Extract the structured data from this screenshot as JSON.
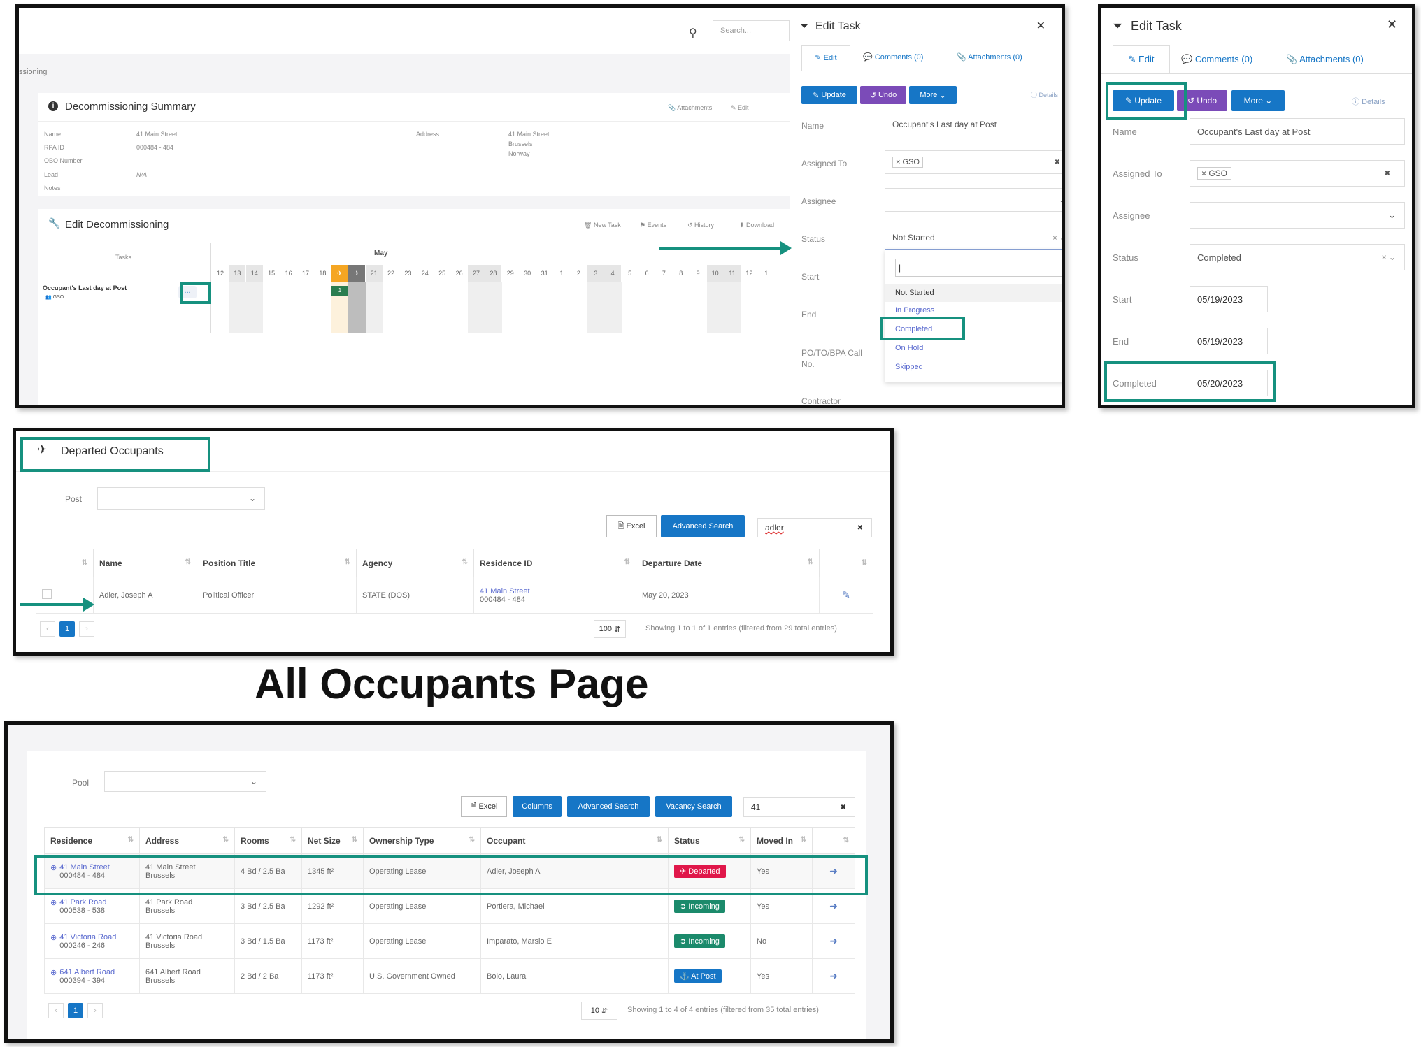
{
  "page_heading": "All Occupants Page",
  "panel1": {
    "search_placeholder": "Search...",
    "breadcrumb": "ssioning",
    "summary_title": "Decommissioning Summary",
    "summary_actions": [
      "Attachments",
      "Edit"
    ],
    "fields": [
      {
        "label": "Name",
        "value": "41 Main Street"
      },
      {
        "label": "RPA ID",
        "value": "000484 - 484"
      },
      {
        "label": "OBO Number",
        "value": ""
      },
      {
        "label": "Lead",
        "value": "N/A"
      },
      {
        "label": "Notes",
        "value": ""
      }
    ],
    "address_label": "Address",
    "address_lines": [
      "41 Main Street",
      "Brussels",
      "Norway"
    ],
    "edit_title": "Edit Decommissioning",
    "edit_actions": [
      "New Task",
      "Events",
      "History",
      "Download"
    ],
    "tasks_label": "Tasks",
    "month": "May",
    "days": [
      "12",
      "13",
      "14",
      "15",
      "16",
      "17",
      "18",
      "19",
      "20",
      "21",
      "22",
      "23",
      "24",
      "25",
      "26",
      "27",
      "28",
      "29",
      "30",
      "31",
      "1",
      "2",
      "3",
      "4",
      "5",
      "6",
      "7",
      "8",
      "9",
      "10",
      "11",
      "12",
      "1"
    ],
    "task_name": "Occupant's Last day at Post",
    "task_assignee": "GSO",
    "task_more": "...",
    "task_bar_label": "1",
    "drawer": {
      "title": "Edit Task",
      "tabs": [
        "Edit",
        "Comments (0)",
        "Attachments (0)"
      ],
      "update": "Update",
      "undo": "Undo",
      "more": "More",
      "details": "Details",
      "name_label": "Name",
      "name_value": "Occupant's Last day at Post",
      "assigned_label": "Assigned To",
      "assigned_value": "GSO",
      "assignee_label": "Assignee",
      "status_label": "Status",
      "status_value": "Not Started",
      "start_label": "Start",
      "end_label": "End",
      "po_label": "PO/TO/BPA Call No.",
      "contractor_label": "Contractor",
      "options": [
        "Not Started",
        "In Progress",
        "Completed",
        "On Hold",
        "Skipped"
      ]
    }
  },
  "panel2": {
    "title": "Edit Task",
    "tabs": [
      "Edit",
      "Comments (0)",
      "Attachments (0)"
    ],
    "update": "Update",
    "undo": "Undo",
    "more": "More",
    "details": "Details",
    "name_label": "Name",
    "name_value": "Occupant's Last day at Post",
    "assigned_label": "Assigned To",
    "assigned_value": "GSO",
    "assignee_label": "Assignee",
    "status_label": "Status",
    "status_value": "Completed",
    "start_label": "Start",
    "start_value": "05/19/2023",
    "end_label": "End",
    "end_value": "05/19/2023",
    "completed_label": "Completed",
    "completed_value": "05/20/2023"
  },
  "panel3": {
    "title": "Departed Occupants",
    "post_label": "Post",
    "excel": "Excel",
    "advanced_search": "Advanced Search",
    "search_value": "adler",
    "columns": [
      "Name",
      "Position Title",
      "Agency",
      "Residence ID",
      "Departure Date"
    ],
    "row": {
      "name": "Adler, Joseph A",
      "position": "Political Officer",
      "agency": "STATE (DOS)",
      "residence_line1": "41 Main Street",
      "residence_line2": "000484 - 484",
      "departure": "May 20, 2023"
    },
    "page": "1",
    "page_size": "100",
    "showing": "Showing 1 to 1 of 1 entries (filtered from 29 total entries)"
  },
  "panel4": {
    "pool_label": "Pool",
    "excel": "Excel",
    "columns_btn": "Columns",
    "advanced_search": "Advanced Search",
    "vacancy_search": "Vacancy Search",
    "search_value": "41",
    "columns": [
      "Residence",
      "Address",
      "Rooms",
      "Net Size",
      "Ownership Type",
      "Occupant",
      "Status",
      "Moved In"
    ],
    "rows": [
      {
        "res1": "41 Main Street",
        "res2": "000484 - 484",
        "addr1": "41 Main Street",
        "addr2": "Brussels",
        "rooms": "4 Bd / 2.5 Ba",
        "size": "1345 ft²",
        "own": "Operating Lease",
        "occupant": "Adler, Joseph A",
        "status": "Departed",
        "moved": "Yes"
      },
      {
        "res1": "41 Park Road",
        "res2": "000538 - 538",
        "addr1": "41 Park Road",
        "addr2": "Brussels",
        "rooms": "3 Bd / 2.5 Ba",
        "size": "1292 ft²",
        "own": "Operating Lease",
        "occupant": "Portiera, Michael",
        "status": "Incoming",
        "moved": "Yes"
      },
      {
        "res1": "41 Victoria Road",
        "res2": "000246 - 246",
        "addr1": "41 Victoria Road",
        "addr2": "Brussels",
        "rooms": "3 Bd / 1.5 Ba",
        "size": "1173 ft²",
        "own": "Operating Lease",
        "occupant": "Imparato, Marsio E",
        "status": "Incoming",
        "moved": "No"
      },
      {
        "res1": "641 Albert Road",
        "res2": "000394 - 394",
        "addr1": "641 Albert Road",
        "addr2": "Brussels",
        "rooms": "2 Bd / 2 Ba",
        "size": "1173 ft²",
        "own": "U.S. Government Owned",
        "occupant": "Bolo, Laura",
        "status": "At Post",
        "moved": "Yes"
      }
    ],
    "page": "1",
    "page_size": "10",
    "showing": "Showing 1 to 4 of 4 entries (filtered from 35 total entries)"
  },
  "colors": {
    "accent": "#16917f",
    "primary": "#1676c6",
    "purple": "#7b4bb8",
    "departed": "#e0174a",
    "incoming": "#1b8a6b",
    "atpost": "#1676c6",
    "gantt_today": "#f5a623"
  }
}
